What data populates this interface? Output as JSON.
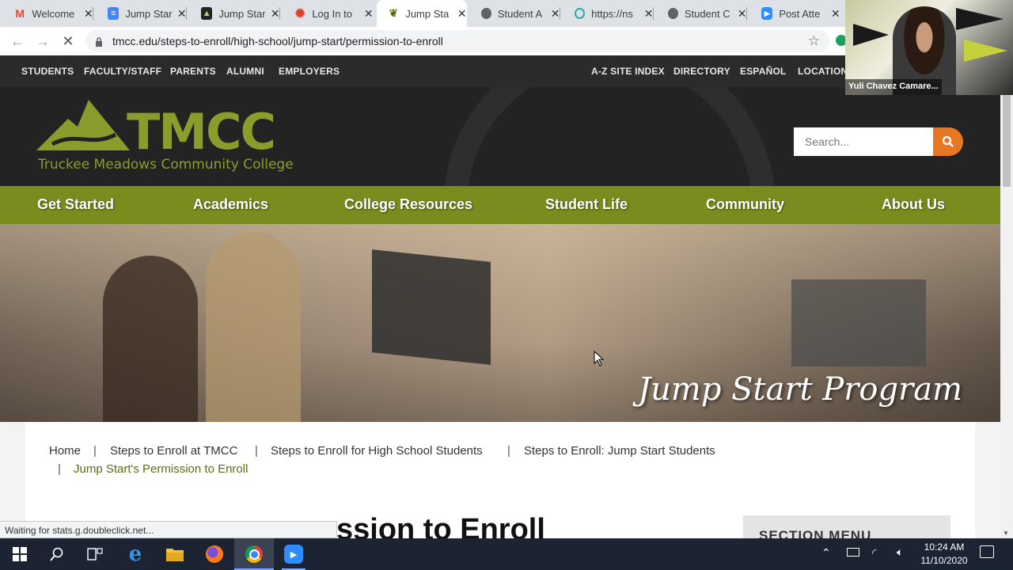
{
  "browser": {
    "tabs": [
      {
        "title": "Welcome",
        "favicon": "gmail-icon",
        "color": "#ea4335"
      },
      {
        "title": "Jump Star",
        "favicon": "docs-icon",
        "color": "#4285f4"
      },
      {
        "title": "Jump Star",
        "favicon": "tmcc-icon",
        "color": "#7a8c1e"
      },
      {
        "title": "Log In to",
        "favicon": "canvas-icon",
        "color": "#e13f2b"
      },
      {
        "title": "Jump Sta",
        "favicon": "tmcc-icon",
        "color": "#7a8c1e",
        "active": true
      },
      {
        "title": "Student A",
        "favicon": "globe-icon",
        "color": "#5f6368"
      },
      {
        "title": "https://ns",
        "favicon": "loading-icon",
        "color": "#3aa"
      },
      {
        "title": "Student C",
        "favicon": "globe-icon",
        "color": "#5f6368"
      },
      {
        "title": "Post Atte",
        "favicon": "zoom-icon",
        "color": "#2d8cff"
      }
    ],
    "url": "tmcc.edu/steps-to-enroll/high-school/jump-start/permission-to-enroll",
    "status": "Waiting for stats.g.doubleclick.net..."
  },
  "site": {
    "top_links_left": [
      "STUDENTS",
      "FACULTY/STAFF",
      "PARENTS",
      "ALUMNI",
      "EMPLOYERS"
    ],
    "top_links_right": [
      "A-Z SITE INDEX",
      "DIRECTORY",
      "ESPAÑOL",
      "LOCATION"
    ],
    "logo_text": "TMCC",
    "logo_subtitle": "Truckee Meadows Community College",
    "search_placeholder": "Search...",
    "main_nav": [
      "Get Started",
      "Academics",
      "College Resources",
      "Student Life",
      "Community",
      "About Us"
    ],
    "hero_title": "Jump Start Program",
    "breadcrumbs": [
      "Home",
      "Steps to Enroll at TMCC",
      "Steps to Enroll for High School Students",
      "Steps to Enroll: Jump Start Students"
    ],
    "breadcrumb_current": "Jump Start's Permission to Enroll",
    "page_heading_visible": "ssion to Enroll",
    "section_menu": "SECTION MENU",
    "brand_green": "#7a8c1e",
    "accent_orange": "#e87722"
  },
  "video": {
    "participant_name": "Yuli Chavez Camare..."
  },
  "taskbar": {
    "time": "10:24 AM",
    "date": "11/10/2020",
    "apps": [
      "start-icon",
      "search-icon",
      "task-view-icon",
      "edge-icon",
      "file-explorer-icon",
      "firefox-icon",
      "chrome-icon",
      "zoom-icon"
    ]
  }
}
